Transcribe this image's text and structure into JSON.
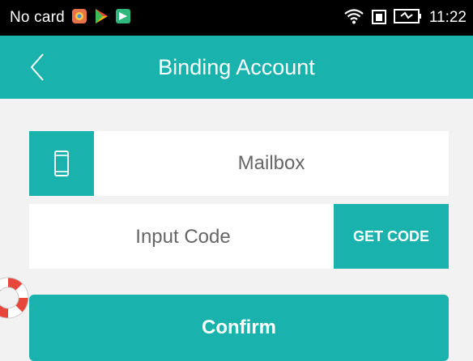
{
  "status_bar": {
    "carrier": "No card",
    "time": "11:22",
    "notification_icons": [
      "app-icon",
      "play-store-icon",
      "download-icon"
    ],
    "system_icons": [
      "wifi-icon",
      "sim-icon",
      "battery-icon"
    ]
  },
  "app_bar": {
    "title": "Binding Account",
    "back_icon": "chevron-left-icon"
  },
  "form": {
    "mailbox": {
      "icon": "phone-icon",
      "value": "",
      "placeholder": "Mailbox"
    },
    "code": {
      "value": "",
      "placeholder": "Input Code"
    },
    "get_code_label": "GET CODE",
    "confirm_label": "Confirm"
  },
  "floating_widget": {
    "icon": "lifebuoy-icon"
  },
  "colors": {
    "accent": "#1ab2ad",
    "background": "#f2f2f2",
    "status_bar": "#000000",
    "field_background": "#ffffff"
  }
}
